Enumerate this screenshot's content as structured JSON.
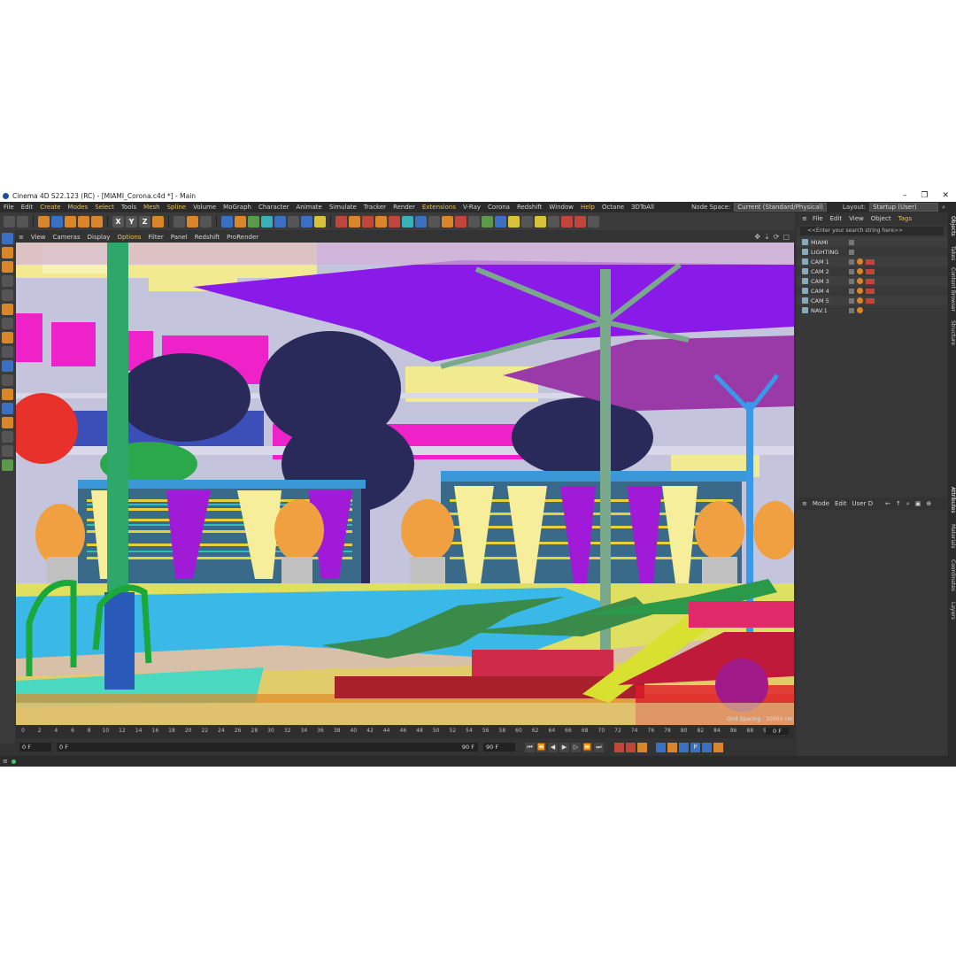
{
  "window": {
    "title": "Cinema 4D S22.123 (RC) - [MIAMI_Corona.c4d *] - Main",
    "min": "–",
    "max": "❐",
    "close": "✕"
  },
  "menu": {
    "items": [
      {
        "label": "File",
        "hl": false
      },
      {
        "label": "Edit",
        "hl": false
      },
      {
        "label": "Create",
        "hl": true
      },
      {
        "label": "Modes",
        "hl": true
      },
      {
        "label": "Select",
        "hl": true
      },
      {
        "label": "Tools",
        "hl": false
      },
      {
        "label": "Mesh",
        "hl": true
      },
      {
        "label": "Spline",
        "hl": true
      },
      {
        "label": "Volume",
        "hl": false
      },
      {
        "label": "MoGraph",
        "hl": false
      },
      {
        "label": "Character",
        "hl": false
      },
      {
        "label": "Animate",
        "hl": false
      },
      {
        "label": "Simulate",
        "hl": false
      },
      {
        "label": "Tracker",
        "hl": false
      },
      {
        "label": "Render",
        "hl": false
      },
      {
        "label": "Extensions",
        "hl": true
      },
      {
        "label": "V-Ray",
        "hl": false
      },
      {
        "label": "Corona",
        "hl": false
      },
      {
        "label": "Redshift",
        "hl": false
      },
      {
        "label": "Window",
        "hl": false
      },
      {
        "label": "Help",
        "hl": true
      },
      {
        "label": "Octane",
        "hl": false
      },
      {
        "label": "3DToAll",
        "hl": false
      }
    ],
    "node_space_label": "Node Space:",
    "node_space_value": "Current (Standard/Physical)",
    "layout_label": "Layout:",
    "layout_value": "Startup (User)"
  },
  "viewport_menu": {
    "items": [
      {
        "label": "View",
        "hl": false
      },
      {
        "label": "Cameras",
        "hl": false
      },
      {
        "label": "Display",
        "hl": false
      },
      {
        "label": "Options",
        "hl": true
      },
      {
        "label": "Filter",
        "hl": false
      },
      {
        "label": "Panel",
        "hl": false
      },
      {
        "label": "Redshift",
        "hl": false
      },
      {
        "label": "ProRender",
        "hl": false
      }
    ]
  },
  "viewport": {
    "grid_spacing": "Grid Spacing : 10000 cm"
  },
  "timeline": {
    "ticks": [
      "0",
      "2",
      "4",
      "6",
      "8",
      "10",
      "12",
      "14",
      "16",
      "18",
      "20",
      "22",
      "24",
      "26",
      "28",
      "30",
      "32",
      "34",
      "36",
      "38",
      "40",
      "42",
      "44",
      "46",
      "48",
      "50",
      "52",
      "54",
      "56",
      "58",
      "60",
      "62",
      "64",
      "66",
      "68",
      "70",
      "72",
      "74",
      "76",
      "78",
      "80",
      "82",
      "84",
      "86",
      "88",
      "90"
    ],
    "current_frame": "0 F"
  },
  "playbar": {
    "start": "0 F",
    "range_start": "0 F",
    "range_end": "90 F",
    "end": "90 F"
  },
  "objects_panel": {
    "menu": [
      {
        "label": "File",
        "hl": false
      },
      {
        "label": "Edit",
        "hl": false
      },
      {
        "label": "View",
        "hl": false
      },
      {
        "label": "Object",
        "hl": false
      },
      {
        "label": "Tags",
        "hl": true
      }
    ],
    "search_placeholder": "<<Enter your search string here>>",
    "rows": [
      {
        "name": "MIAMI",
        "tags": 0
      },
      {
        "name": "LIGHTING",
        "tags": 0
      },
      {
        "name": "CAM 1",
        "tags": 2
      },
      {
        "name": "CAM 2",
        "tags": 2
      },
      {
        "name": "CAM 3",
        "tags": 2
      },
      {
        "name": "CAM 4",
        "tags": 2
      },
      {
        "name": "CAM 5",
        "tags": 2
      },
      {
        "name": "NAV.1",
        "tags": 1
      }
    ]
  },
  "attributes_panel": {
    "menu": [
      "Mode",
      "Edit",
      "User D"
    ]
  },
  "side_tabs": {
    "top": [
      "Objects",
      "Takes",
      "Content Browser",
      "Structure"
    ],
    "bottom": [
      "Attributes",
      "Materials",
      "Coordinates",
      "Layers"
    ]
  }
}
